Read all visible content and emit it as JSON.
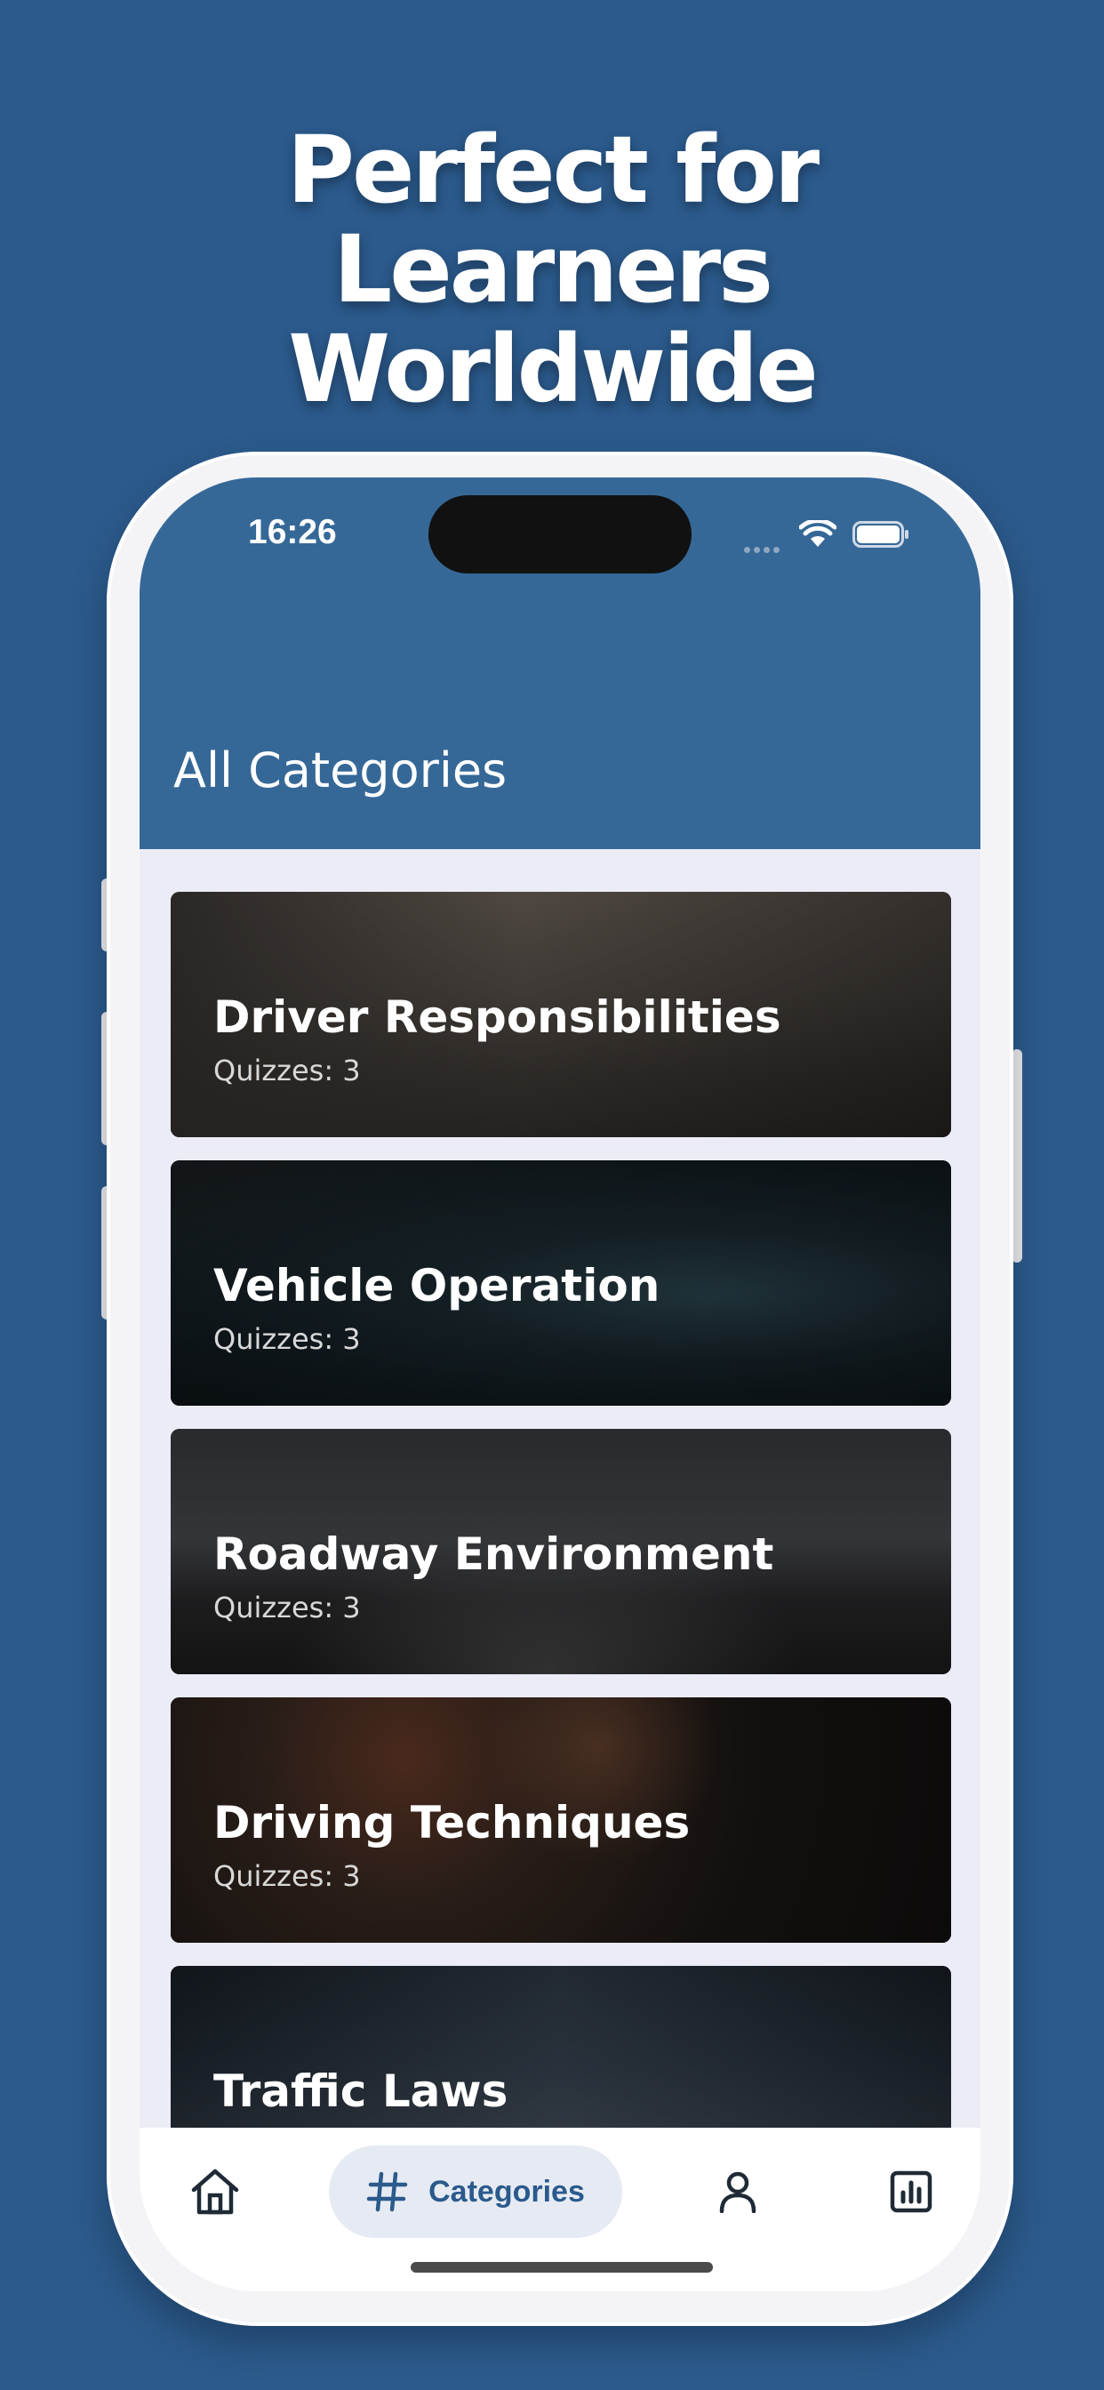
{
  "headline": [
    "Perfect for",
    "Learners",
    "Worldwide"
  ],
  "status_bar": {
    "time": "16:26"
  },
  "header": {
    "title": "All Categories"
  },
  "categories": [
    {
      "title": "Driver Responsibilities",
      "quizzes": "Quizzes: 3"
    },
    {
      "title": "Vehicle Operation",
      "quizzes": "Quizzes: 3"
    },
    {
      "title": "Roadway Environment",
      "quizzes": "Quizzes: 3"
    },
    {
      "title": "Driving Techniques",
      "quizzes": "Quizzes: 3"
    },
    {
      "title": "Traffic Laws",
      "quizzes": ""
    }
  ],
  "tabbar": {
    "items": [
      {
        "icon": "home-icon",
        "label": ""
      },
      {
        "icon": "hashtag-icon",
        "label": "Categories"
      },
      {
        "icon": "person-icon",
        "label": ""
      },
      {
        "icon": "chart-icon",
        "label": ""
      }
    ],
    "active_index": 1
  },
  "colors": {
    "background": "#2b5a8c",
    "header": "#356897",
    "accent": "#2b5a8c",
    "active_tab_bg": "#e6ebf3"
  }
}
